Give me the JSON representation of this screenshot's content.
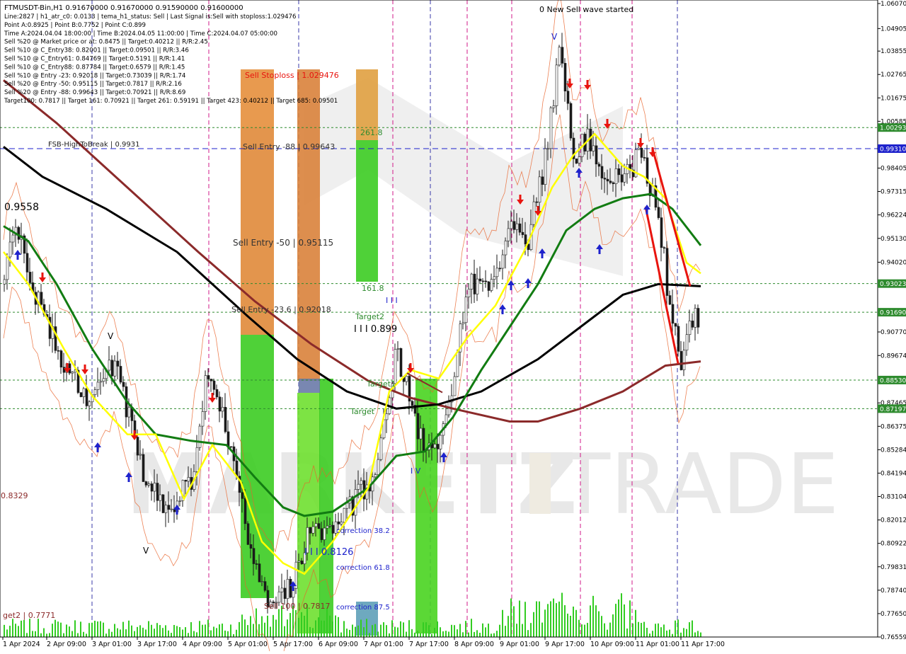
{
  "header": {
    "symbol_line": "FTMUSDT-Bin,H1  0.91670000 0.91670000 0.91590000 0.91600000",
    "info_lines": [
      "Line:2827  | h1_atr_c0: 0.0133  | tema_h1_status: Sell  | Last Signal is:Sell with stoploss:1.029476",
      "Point A:0.8925  | Point B:0.7752  | Point C:0.899",
      "Time A:2024.04.04 18:00:00  | Time B:2024.04.05 11:00:00  | Time C:2024.04.07 05:00:00",
      "Sell %20 @ Market price or at: 0.8475  || Target:0.40212  || R/R:2.45",
      "Sell %10 @ C_Entry38: 0.82001  || Target:0.09501  || R/R:3.46",
      "Sell %10 @ C_Entry61: 0.84769  || Target:0.5191  || R/R:1.41",
      "Sell %10 @ C_Entry88: 0.87784  || Target:0.6579  || R/R:1.45",
      "Sell %10 @ Entry -23: 0.92018  || Target:0.73039  || R/R:1.74",
      "Sell %20 @ Entry -50: 0.95115  || Target:0.7817  || R/R:2.16",
      "Sell %20 @ Entry -88: 0.99643  || Target:0.70921  || R/R:8.69",
      "Target100: 0.7817  || Target 161: 0.70921  || Target 261: 0.59191  || Target 423: 0.40212  || Target 685: 0.09501"
    ],
    "wave_note": "0 New Sell wave started"
  },
  "chart_data": {
    "type": "candlestick",
    "symbol": "FTMUSDT-Bin",
    "timeframe": "H1",
    "ylim": [
      0.7655,
      1.0615
    ],
    "x_ticks": [
      "1 Apr 2024",
      "2 Apr 09:00",
      "3 Apr 01:00",
      "3 Apr 17:00",
      "4 Apr 09:00",
      "5 Apr 01:00",
      "5 Apr 17:00",
      "6 Apr 09:00",
      "7 Apr 01:00",
      "7 Apr 17:00",
      "8 Apr 09:00",
      "9 Apr 01:00",
      "9 Apr 17:00",
      "10 Apr 09:00",
      "11 Apr 01:00",
      "11 Apr 17:00"
    ],
    "y_ticks": [
      "1.06070",
      "1.04905",
      "1.03855",
      "1.02765",
      "1.01675",
      "1.00585",
      "0.98405",
      "0.97315",
      "0.96224",
      "0.95130",
      "0.94020",
      "0.90770",
      "0.89674",
      "0.87465",
      "0.86375",
      "0.85284",
      "0.84194",
      "0.83104",
      "0.82012",
      "0.80922",
      "0.79831",
      "0.78740",
      "0.77650",
      "0.76559"
    ],
    "price_tags": [
      {
        "label": "1.00293",
        "value": 1.00293,
        "color": "#2e8b2e"
      },
      {
        "label": "0.99310",
        "value": 0.9931,
        "color": "#1e22cc"
      },
      {
        "label": "0.93023",
        "value": 0.93023,
        "color": "#2e8b2e"
      },
      {
        "label": "0.91690",
        "value": 0.9169,
        "color": "#2e8b2e"
      },
      {
        "label": "0.88530",
        "value": 0.8853,
        "color": "#2e8b2e"
      },
      {
        "label": "0.87197",
        "value": 0.87197,
        "color": "#2e8b2e"
      }
    ],
    "levels": [
      {
        "label": "FSB-HighToBreak  | 0.9931",
        "value": 0.9931,
        "style": "blue-dash"
      },
      {
        "label": "Sell Entry -88  | 0.99643",
        "value": 0.99643
      },
      {
        "label": "Sell Entry -50  | 0.95115",
        "value": 0.95115
      },
      {
        "label": "Sell Entry -23.6  | 0.92018",
        "value": 0.92018
      },
      {
        "label": "Sell Stoploss  | 1.029476",
        "value": 1.029476
      },
      {
        "label": "Sell 100  | 0.7817",
        "value": 0.7817
      }
    ],
    "annotations": [
      "0.9558",
      "0.8329",
      "get2  | 0.7771",
      "261.8",
      "161.8",
      "Target2",
      "Target1",
      "Target",
      "I I I 0.899",
      "I I I 0.8126",
      "correction 38.2",
      "correction 61.8",
      "correction 87.5",
      "I I I",
      "I V",
      "V",
      "V",
      "V"
    ],
    "key_closes": [
      0.9558,
      0.925,
      0.8925,
      0.875,
      0.8329,
      0.8126,
      0.7817,
      0.84,
      0.899,
      0.86,
      0.85,
      0.93,
      0.99,
      1.04,
      0.99,
      0.975,
      0.893,
      0.916
    ],
    "last_close": 0.916,
    "watermark": "MARKETZ TRADE"
  },
  "colors": {
    "bull": "#1a1a1a",
    "bear": "#1a1a1a",
    "ma_yellow": "#ffff00",
    "ma_green": "#127c12",
    "ma_black": "#000000",
    "ma_darkred": "#8b2a2a",
    "orange_zone": "#d9823b",
    "green_zone": "#33cc22",
    "signal_red": "#e8140e",
    "signal_blue": "#1e22cc"
  }
}
